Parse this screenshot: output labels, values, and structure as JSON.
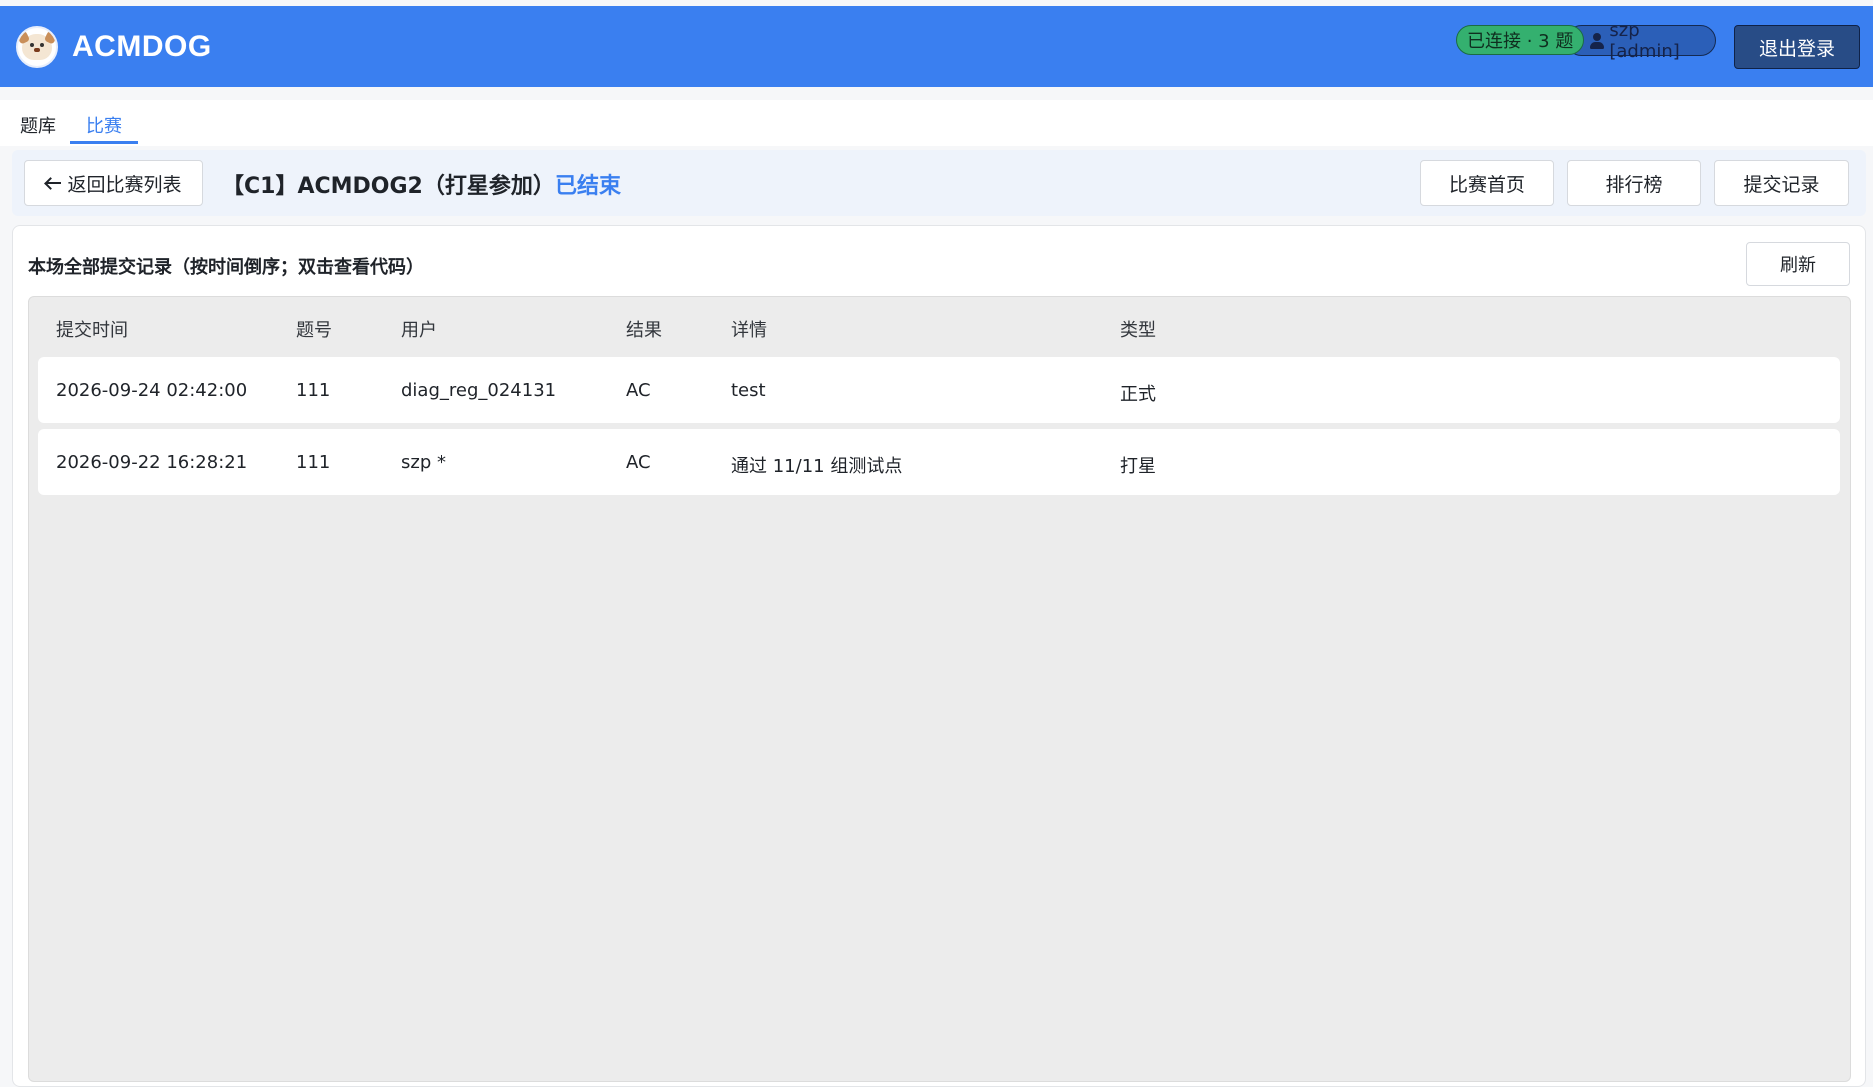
{
  "header": {
    "brand": "ACMDOG",
    "status_pill": "已连接 · 3 题",
    "user_pill": "szp [admin]",
    "logout_label": "退出登录"
  },
  "nav": {
    "tabs": [
      {
        "label": "题库",
        "active": false
      },
      {
        "label": "比赛",
        "active": true
      }
    ]
  },
  "contest": {
    "back_label": "返回比赛列表",
    "title": "【C1】ACMDOG2（打星参加）",
    "status": "已结束",
    "actions": {
      "home": "比赛首页",
      "rank": "排行榜",
      "submissions": "提交记录"
    }
  },
  "submissions": {
    "title": "本场全部提交记录（按时间倒序；双击查看代码）",
    "refresh_label": "刷新",
    "columns": [
      "提交时间",
      "题号",
      "用户",
      "结果",
      "详情",
      "类型"
    ],
    "rows": [
      {
        "time": "2026-09-24 02:42:00",
        "pid": "111",
        "user": "diag_reg_024131",
        "result": "AC",
        "detail": "test",
        "type": "正式"
      },
      {
        "time": "2026-09-22 16:28:21",
        "pid": "111",
        "user": "szp *",
        "result": "AC",
        "detail": "通过 11/11 组测试点",
        "type": "打星"
      }
    ]
  },
  "colors": {
    "header_blue": "#3a7ff0",
    "status_green": "#34b06f",
    "logout_bg": "#284c86",
    "panel_bg": "#eef3fb",
    "table_bg": "#ececec"
  }
}
